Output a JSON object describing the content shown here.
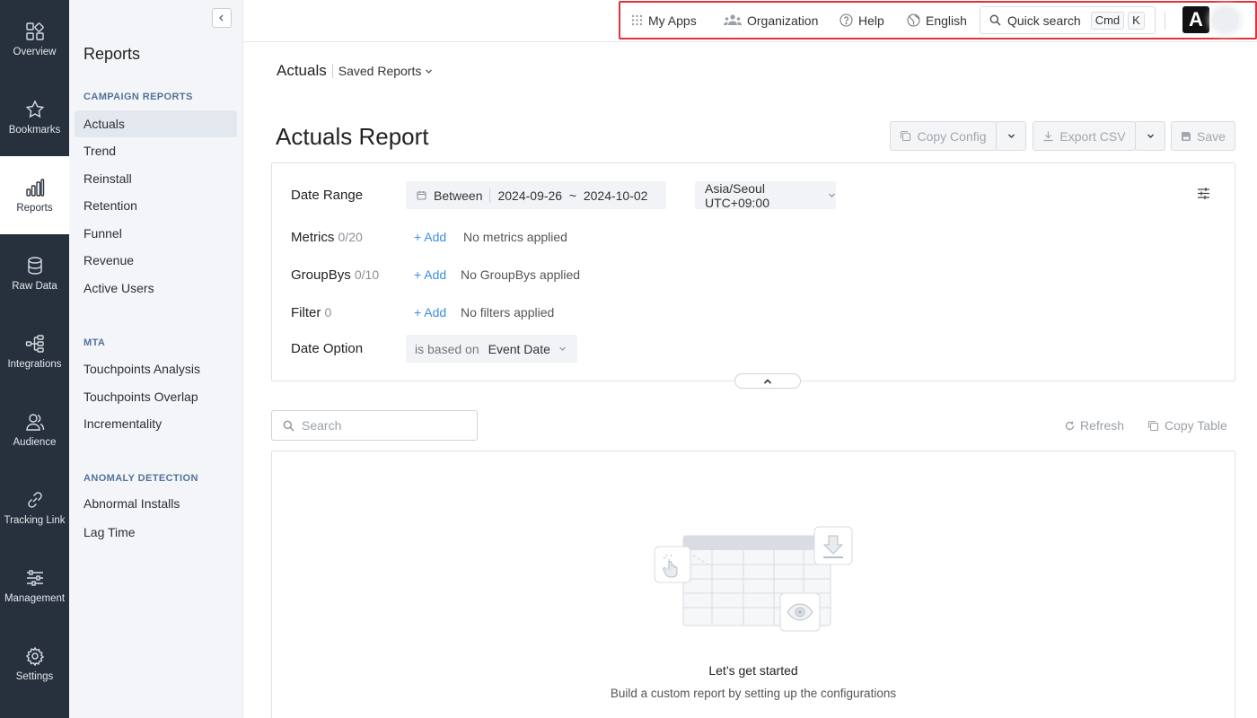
{
  "rail": {
    "items": [
      {
        "label": "Overview",
        "icon": "overview-icon"
      },
      {
        "label": "Bookmarks",
        "icon": "star-icon"
      },
      {
        "label": "Reports",
        "icon": "bar-chart-icon",
        "active": true
      },
      {
        "label": "Raw Data",
        "icon": "database-icon"
      },
      {
        "label": "Integrations",
        "icon": "integrations-icon"
      },
      {
        "label": "Audience",
        "icon": "audience-icon"
      },
      {
        "label": "Tracking Link",
        "icon": "link-icon"
      },
      {
        "label": "Management",
        "icon": "sliders-icon"
      },
      {
        "label": "Settings",
        "icon": "gear-icon"
      }
    ]
  },
  "sidebar": {
    "title": "Reports",
    "sections": [
      {
        "title": "CAMPAIGN REPORTS",
        "items": [
          "Actuals",
          "Trend",
          "Reinstall",
          "Retention",
          "Funnel",
          "Revenue",
          "Active Users"
        ]
      },
      {
        "title": "MTA",
        "items": [
          "Touchpoints Analysis",
          "Touchpoints Overlap",
          "Incrementality"
        ]
      },
      {
        "title": "ANOMALY DETECTION",
        "items": [
          "Abnormal Installs",
          "Lag Time"
        ]
      }
    ],
    "active_item": "Actuals"
  },
  "topnav": {
    "my_apps": "My Apps",
    "organization": "Organization",
    "help": "Help",
    "language": "English",
    "quick_search": "Quick search",
    "kbd_cmd": "Cmd",
    "kbd_k": "K",
    "logo_letter": "A"
  },
  "breadcrumb": {
    "current": "Actuals",
    "saved_reports": "Saved Reports"
  },
  "page": {
    "title": "Actuals Report"
  },
  "toolbar": {
    "copy_config": "Copy Config",
    "export_csv": "Export CSV",
    "save": "Save"
  },
  "config": {
    "date_range": {
      "label": "Date Range",
      "mode": "Between",
      "value": "2024-09-26  ~  2024-10-02",
      "timezone": "Asia/Seoul UTC+09:00"
    },
    "metrics": {
      "label": "Metrics",
      "count": "0/20",
      "add": "+ Add",
      "empty": "No metrics applied"
    },
    "groupbys": {
      "label": "GroupBys",
      "count": "0/10",
      "add": "+ Add",
      "empty": "No GroupBys applied"
    },
    "filter": {
      "label": "Filter",
      "count": "0",
      "add": "+ Add",
      "empty": "No filters applied"
    },
    "date_option": {
      "label": "Date Option",
      "prefix": "is based on",
      "value": "Event Date"
    }
  },
  "table": {
    "search_placeholder": "Search",
    "refresh": "Refresh",
    "copy_table": "Copy Table"
  },
  "empty_state": {
    "title": "Let’s get started",
    "subtitle": "Build a custom report by setting up the configurations"
  },
  "colors": {
    "rail_bg": "#27313d",
    "sidebar_bg": "#f3f5f8",
    "link": "#3d8ee0",
    "highlight_border": "#e0323b",
    "section_title": "#52739b"
  }
}
